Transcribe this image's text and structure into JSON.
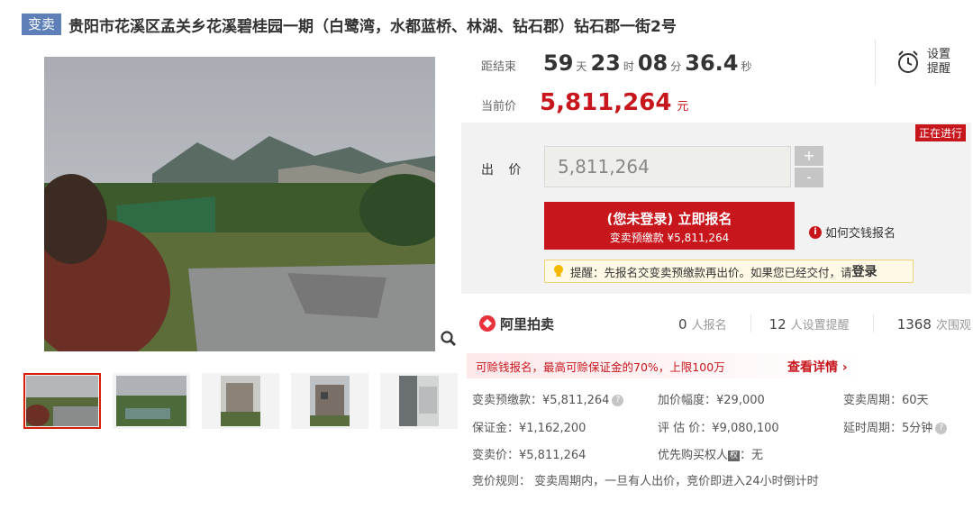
{
  "header": {
    "tag": "变卖",
    "title": "贵阳市花溪区孟关乡花溪碧桂园一期（白鹭湾，水都蓝桥、林湖、钻石郡）钻石郡一街2号"
  },
  "countdown": {
    "label": "距结束",
    "days": "59",
    "days_unit": "天",
    "hours": "23",
    "hours_unit": "时",
    "minutes": "08",
    "minutes_unit": "分",
    "seconds": "36.4",
    "seconds_unit": "秒"
  },
  "current_price": {
    "label": "当前价",
    "value": "5,811,264",
    "unit": "元"
  },
  "reminder": {
    "line1": "设置",
    "line2": "提醒"
  },
  "status": "正在进行",
  "bid": {
    "label": "出 价",
    "value": "5,811,264",
    "plus": "+",
    "minus": "-",
    "button_main": "(您未登录) 立即报名",
    "button_sub": "变卖预缴款 ¥5,811,264",
    "howto": "如何交钱报名",
    "tip_prefix": "提醒：先报名交变卖预缴款再出价。如果您已经交付，请",
    "tip_link": "登录"
  },
  "ali": {
    "name": "阿里拍卖",
    "signups": "0",
    "signups_label": "人报名",
    "reminders": "12",
    "reminders_label": "人设置提醒",
    "watchers": "1368",
    "watchers_label": "次围观"
  },
  "banner": {
    "text": "可赊钱报名，最高可赊保证金的70%，上限100万",
    "link": "查看详情 ›"
  },
  "details": {
    "prepay": "变卖预缴款：¥5,811,264",
    "increment": "加价幅度：¥29,000",
    "cycle": "变卖周期：60天",
    "deposit": "保证金：¥1,162,200",
    "appraisal": "评 估 价：¥9,080,100",
    "delay": "延时周期：5分钟",
    "sale_price": "变卖价：¥5,811,264",
    "priority_label": "优先购买权人",
    "priority_badge": "权",
    "priority_value": "：无",
    "rule": "竞价规则： 变卖周期内，一旦有人出价，竞价即进入24小时倒计时"
  },
  "colors": {
    "accent": "#c8161d",
    "tag_bg": "#5e7fb7"
  },
  "icons": [
    "alarm-clock-icon",
    "zoom-icon",
    "info-icon",
    "lightbulb-icon",
    "ali-logo-icon",
    "help-icon"
  ]
}
